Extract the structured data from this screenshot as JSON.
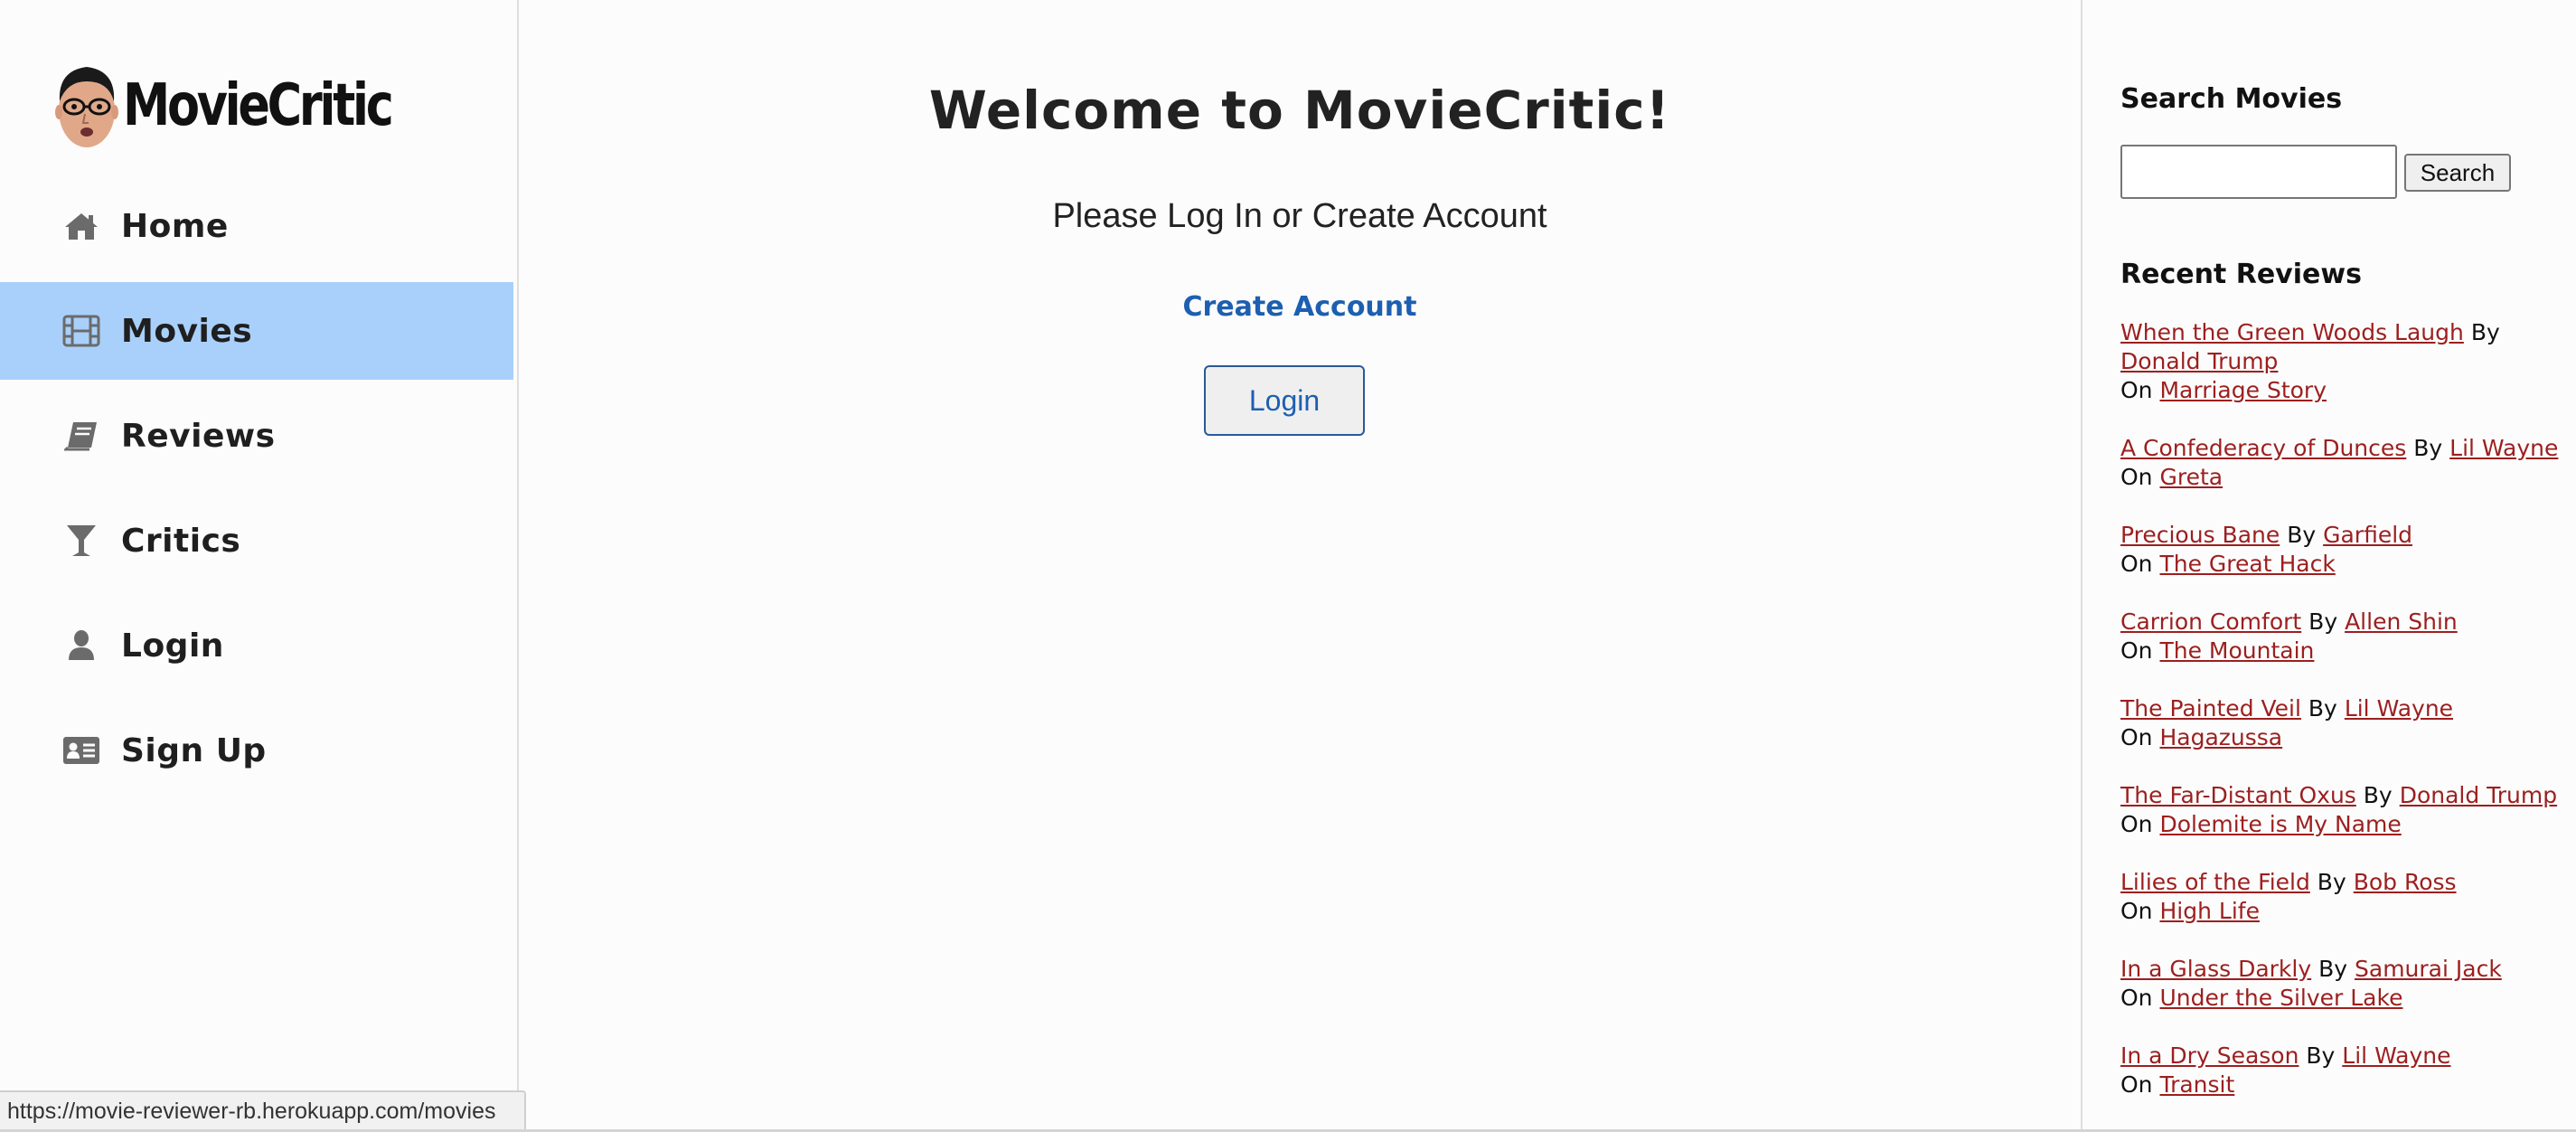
{
  "brand": {
    "name": "MovieCritic",
    "logo_icon": "caricature-face-logo"
  },
  "nav": {
    "items": [
      {
        "label": "Home",
        "icon": "home-icon",
        "active": false
      },
      {
        "label": "Movies",
        "icon": "film-icon",
        "active": true
      },
      {
        "label": "Reviews",
        "icon": "book-icon",
        "active": false
      },
      {
        "label": "Critics",
        "icon": "cocktail-icon",
        "active": false
      },
      {
        "label": "Login",
        "icon": "user-icon",
        "active": false
      },
      {
        "label": "Sign Up",
        "icon": "id-card-icon",
        "active": false
      }
    ],
    "active_color": "#a8d0fb"
  },
  "main": {
    "title": "Welcome to MovieCritic!",
    "subtitle": "Please Log In or Create Account",
    "create_account_label": "Create Account",
    "login_label": "Login"
  },
  "search": {
    "heading": "Search Movies",
    "input_value": "",
    "button_label": "Search"
  },
  "recent_reviews": {
    "heading": "Recent Reviews",
    "by_word": "By",
    "on_word": "On",
    "items": [
      {
        "title": "When the Green Woods Laugh",
        "critic": "Donald Trump",
        "movie": "Marriage Story"
      },
      {
        "title": "A Confederacy of Dunces",
        "critic": "Lil Wayne",
        "movie": "Greta"
      },
      {
        "title": "Precious Bane",
        "critic": "Garfield",
        "movie": "The Great Hack"
      },
      {
        "title": "Carrion Comfort",
        "critic": "Allen Shin",
        "movie": "The Mountain"
      },
      {
        "title": "The Painted Veil",
        "critic": "Lil Wayne",
        "movie": "Hagazussa"
      },
      {
        "title": "The Far-Distant Oxus",
        "critic": "Donald Trump",
        "movie": "Dolemite is My Name"
      },
      {
        "title": "Lilies of the Field",
        "critic": "Bob Ross",
        "movie": "High Life"
      },
      {
        "title": "In a Glass Darkly",
        "critic": "Samurai Jack",
        "movie": "Under the Silver Lake"
      },
      {
        "title": "In a Dry Season",
        "critic": "Lil Wayne",
        "movie": "Transit"
      }
    ],
    "link_color": "#9c1f1f"
  },
  "status_bar": {
    "url": "https://movie-reviewer-rb.herokuapp.com/movies"
  }
}
